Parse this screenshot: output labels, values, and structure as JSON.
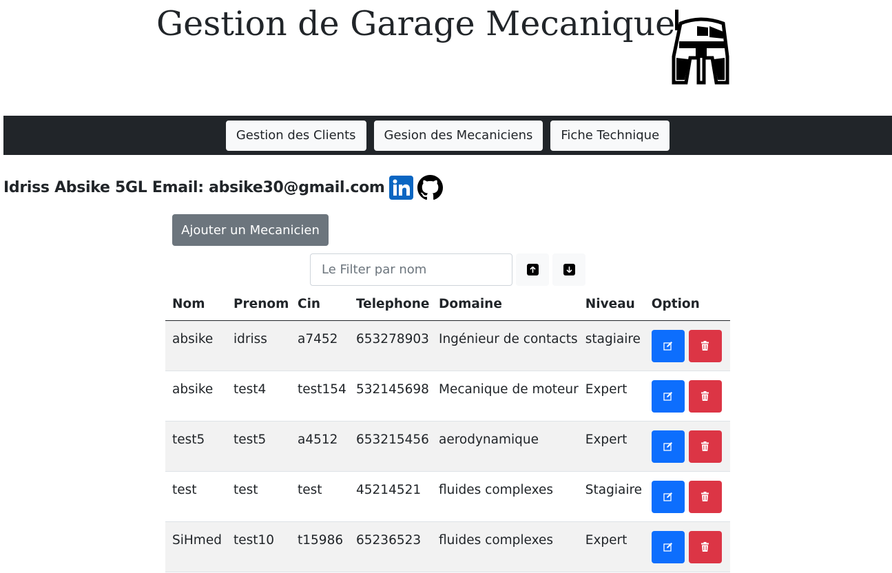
{
  "header": {
    "title": "Gestion de Garage Mecanique",
    "logo_icon": "bounty-hunter-helmet-icon"
  },
  "nav": {
    "items": [
      {
        "label": "Gestion des Clients"
      },
      {
        "label": "Gesion des Mecaniciens"
      },
      {
        "label": "Fiche Technique"
      }
    ]
  },
  "author": {
    "text": "Idriss Absike 5GL Email: absike30@gmail.com",
    "icons": [
      "linkedin-icon",
      "github-icon"
    ]
  },
  "actions": {
    "add_label": "Ajouter un Mecanicien",
    "filter_placeholder": "Le Filter par nom",
    "filter_value": "",
    "sort_asc_icon": "arrow-up-icon",
    "sort_desc_icon": "arrow-down-icon"
  },
  "table": {
    "columns": [
      "Nom",
      "Prenom",
      "Cin",
      "Telephone",
      "Domaine",
      "Niveau",
      "Option"
    ],
    "rows": [
      [
        "absike",
        "idriss",
        "a7452",
        "653278903",
        "Ingénieur de contacts",
        "stagiaire"
      ],
      [
        "absike",
        "test4",
        "test154",
        "532145698",
        "Mecanique de moteur",
        "Expert"
      ],
      [
        "test5",
        "test5",
        "a4512",
        "653215456",
        "aerodynamique",
        "Expert"
      ],
      [
        "test",
        "test",
        "test",
        "45214521",
        "fluides complexes",
        "Stagiaire"
      ],
      [
        "SiHmed",
        "test10",
        "t15986",
        "65236523",
        "fluides complexes",
        "Expert"
      ]
    ],
    "row_actions": {
      "edit_icon": "edit-icon",
      "delete_icon": "trash-icon"
    }
  },
  "colors": {
    "navbar": "#212529",
    "edit_button": "#0d6efd",
    "delete_button": "#dc3545",
    "add_button": "#6c757d",
    "linkedin": "#0a66c2"
  }
}
